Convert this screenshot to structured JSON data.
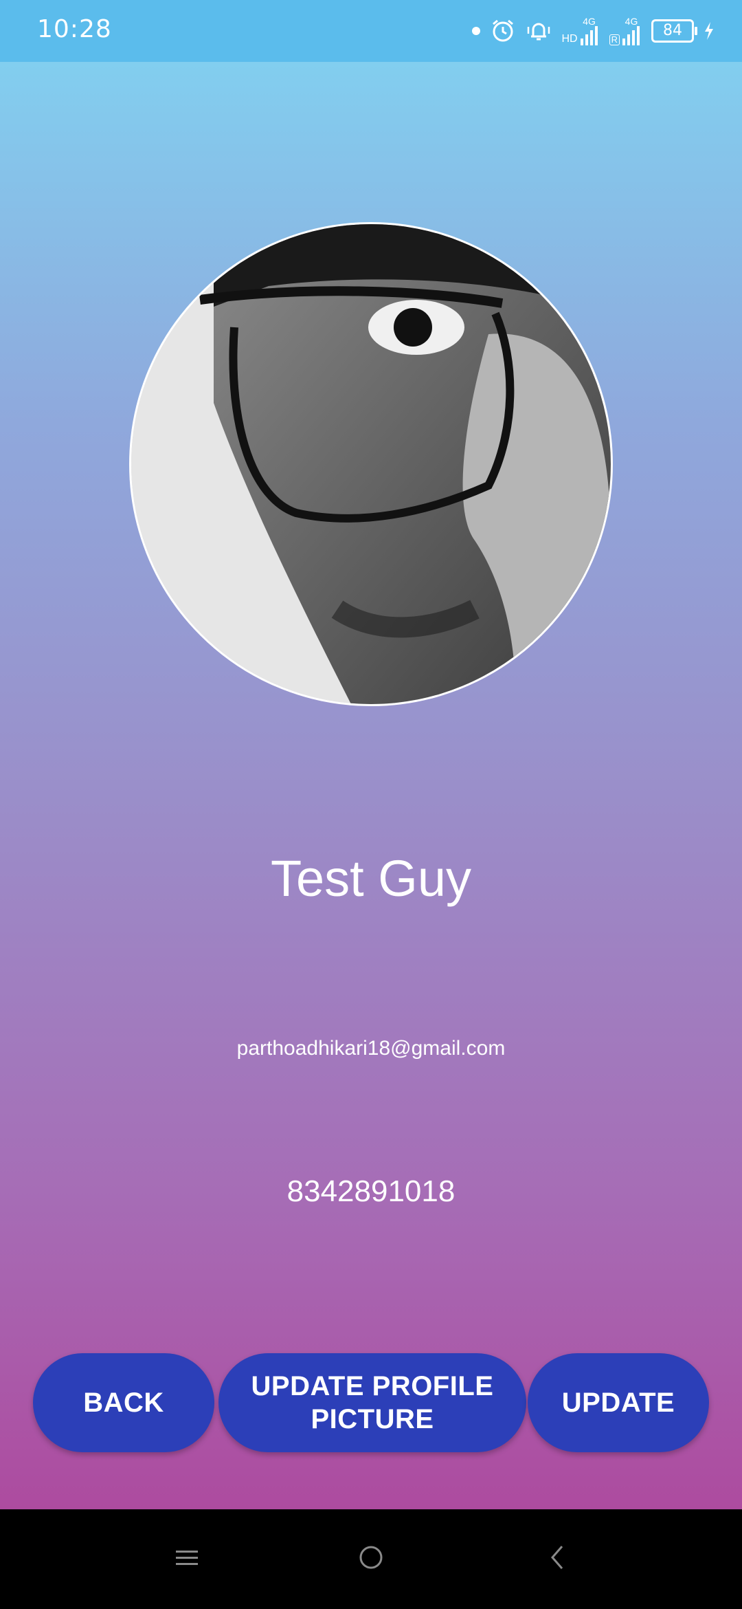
{
  "status_bar": {
    "time": "10:28",
    "battery_level": "84",
    "network_labels": [
      "HD",
      "4G",
      "R",
      "4G"
    ],
    "icons": [
      "notification-dot-icon",
      "alarm-icon",
      "vibrate-bell-icon",
      "signal-icon",
      "signal-icon",
      "battery-icon",
      "charging-icon"
    ]
  },
  "profile": {
    "name": "Test Guy",
    "email": "parthoadhikari18@gmail.com",
    "phone": "8342891018"
  },
  "buttons": {
    "back": "BACK",
    "update_picture_line1": "UPDATE PROFILE",
    "update_picture_line2": "PICTURE",
    "update": "UPDATE"
  },
  "nav_bar": {
    "icons": [
      "menu-icon",
      "home-icon",
      "back-icon"
    ]
  },
  "colors": {
    "status_bar": "#5bbcec",
    "gradient_top": "#82ceef",
    "gradient_bottom": "#ad4b9f",
    "button": "#2c3fb8"
  }
}
